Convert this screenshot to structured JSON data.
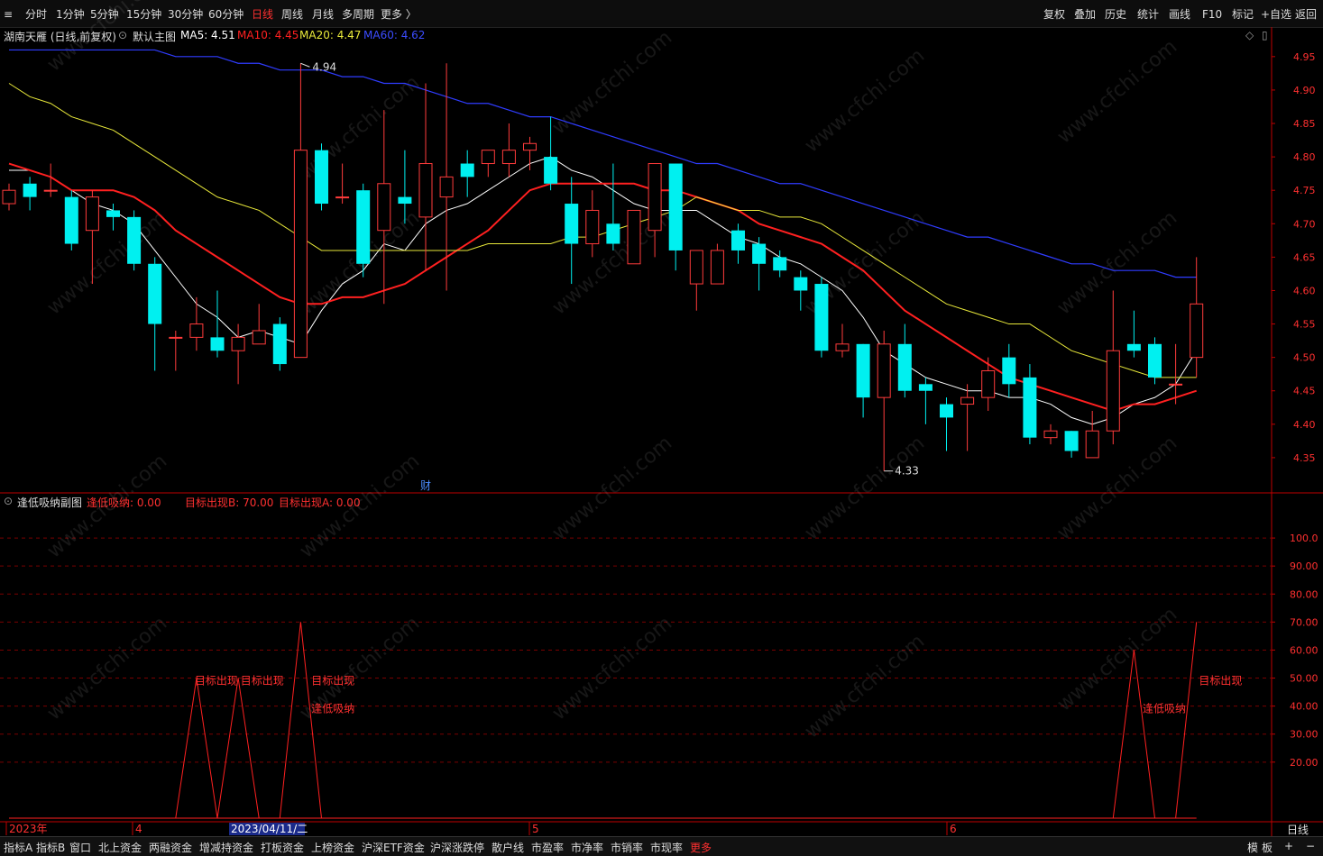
{
  "toolbar": {
    "periods": [
      "分时",
      "1分钟",
      "5分钟",
      "15分钟",
      "30分钟",
      "60分钟",
      "日线",
      "周线",
      "月线",
      "多周期",
      "更多 〉"
    ],
    "active_period": "日线",
    "tools": [
      "复权",
      "叠加",
      "历史",
      "统计",
      "画线",
      "F10",
      "标记",
      "+自选",
      "返回"
    ]
  },
  "main_info": {
    "stock": "湖南天雁 (日线,前复权)",
    "template": "默认主图",
    "ma5": "MA5: 4.51",
    "ma10": "MA10: 4.45",
    "ma20": "MA20: 4.47",
    "ma60": "MA60: 4.62"
  },
  "sub_info": {
    "name": "逢低吸纳副图",
    "v1": "逢低吸纳: 0.00",
    "v2": "目标出现B: 70.00",
    "v3": "目标出现A: 0.00"
  },
  "colors": {
    "up": "#ff3b3b",
    "down": "#00f0f0",
    "ma5": "#ffffff",
    "ma10": "#ff2020",
    "ma20": "#e8e83a",
    "ma60": "#2f3cff",
    "grid": "#7a0000",
    "axis": "#c00000"
  },
  "chart_data": [
    {
      "type": "candlestick",
      "ylim": [
        4.3,
        4.97
      ],
      "y_ticks": [
        "4.95",
        "4.90",
        "4.85",
        "4.80",
        "4.75",
        "4.70",
        "4.65",
        "4.60",
        "4.55",
        "4.50",
        "4.45",
        "4.40",
        "4.35"
      ],
      "x_labels": [
        "2023年",
        "4",
        "5",
        "6"
      ],
      "cursor_date": "2023/04/11/二",
      "period_label": "日线",
      "annotations": {
        "high": "4.94",
        "low": "4.33",
        "event": "财"
      },
      "candles": [
        {
          "o": 4.73,
          "h": 4.76,
          "l": 4.72,
          "c": 4.75
        },
        {
          "o": 4.76,
          "h": 4.77,
          "l": 4.72,
          "c": 4.74
        },
        {
          "o": 4.75,
          "h": 4.79,
          "l": 4.74,
          "c": 4.75
        },
        {
          "o": 4.74,
          "h": 4.75,
          "l": 4.66,
          "c": 4.67
        },
        {
          "o": 4.69,
          "h": 4.75,
          "l": 4.61,
          "c": 4.74
        },
        {
          "o": 4.72,
          "h": 4.73,
          "l": 4.69,
          "c": 4.71
        },
        {
          "o": 4.71,
          "h": 4.72,
          "l": 4.63,
          "c": 4.64
        },
        {
          "o": 4.64,
          "h": 4.65,
          "l": 4.48,
          "c": 4.55
        },
        {
          "o": 4.53,
          "h": 4.54,
          "l": 4.48,
          "c": 4.53
        },
        {
          "o": 4.53,
          "h": 4.59,
          "l": 4.51,
          "c": 4.55
        },
        {
          "o": 4.53,
          "h": 4.6,
          "l": 4.5,
          "c": 4.51
        },
        {
          "o": 4.51,
          "h": 4.55,
          "l": 4.46,
          "c": 4.53
        },
        {
          "o": 4.52,
          "h": 4.58,
          "l": 4.52,
          "c": 4.54
        },
        {
          "o": 4.55,
          "h": 4.56,
          "l": 4.48,
          "c": 4.49
        },
        {
          "o": 4.5,
          "h": 4.94,
          "l": 4.5,
          "c": 4.81
        },
        {
          "o": 4.81,
          "h": 4.82,
          "l": 4.72,
          "c": 4.73
        },
        {
          "o": 4.74,
          "h": 4.79,
          "l": 4.73,
          "c": 4.74
        },
        {
          "o": 4.75,
          "h": 4.76,
          "l": 4.62,
          "c": 4.64
        },
        {
          "o": 4.69,
          "h": 4.87,
          "l": 4.58,
          "c": 4.76
        },
        {
          "o": 4.74,
          "h": 4.81,
          "l": 4.7,
          "c": 4.73
        },
        {
          "o": 4.71,
          "h": 4.91,
          "l": 4.63,
          "c": 4.79
        },
        {
          "o": 4.74,
          "h": 4.94,
          "l": 4.6,
          "c": 4.77
        },
        {
          "o": 4.79,
          "h": 4.81,
          "l": 4.74,
          "c": 4.77
        },
        {
          "o": 4.79,
          "h": 4.81,
          "l": 4.77,
          "c": 4.81
        },
        {
          "o": 4.79,
          "h": 4.85,
          "l": 4.77,
          "c": 4.81
        },
        {
          "o": 4.81,
          "h": 4.83,
          "l": 4.78,
          "c": 4.82
        },
        {
          "o": 4.8,
          "h": 4.86,
          "l": 4.75,
          "c": 4.76
        },
        {
          "o": 4.73,
          "h": 4.77,
          "l": 4.61,
          "c": 4.67
        },
        {
          "o": 4.67,
          "h": 4.75,
          "l": 4.65,
          "c": 4.72
        },
        {
          "o": 4.7,
          "h": 4.79,
          "l": 4.66,
          "c": 4.67
        },
        {
          "o": 4.64,
          "h": 4.72,
          "l": 4.64,
          "c": 4.72
        },
        {
          "o": 4.69,
          "h": 4.79,
          "l": 4.65,
          "c": 4.79
        },
        {
          "o": 4.79,
          "h": 4.79,
          "l": 4.63,
          "c": 4.66
        },
        {
          "o": 4.61,
          "h": 4.66,
          "l": 4.57,
          "c": 4.66
        },
        {
          "o": 4.61,
          "h": 4.67,
          "l": 4.61,
          "c": 4.66
        },
        {
          "o": 4.69,
          "h": 4.7,
          "l": 4.64,
          "c": 4.66
        },
        {
          "o": 4.67,
          "h": 4.68,
          "l": 4.6,
          "c": 4.64
        },
        {
          "o": 4.65,
          "h": 4.66,
          "l": 4.62,
          "c": 4.63
        },
        {
          "o": 4.62,
          "h": 4.63,
          "l": 4.57,
          "c": 4.6
        },
        {
          "o": 4.61,
          "h": 4.62,
          "l": 4.5,
          "c": 4.51
        },
        {
          "o": 4.51,
          "h": 4.55,
          "l": 4.5,
          "c": 4.52
        },
        {
          "o": 4.52,
          "h": 4.52,
          "l": 4.41,
          "c": 4.44
        },
        {
          "o": 4.44,
          "h": 4.54,
          "l": 4.33,
          "c": 4.52
        },
        {
          "o": 4.52,
          "h": 4.55,
          "l": 4.44,
          "c": 4.45
        },
        {
          "o": 4.46,
          "h": 4.47,
          "l": 4.4,
          "c": 4.45
        },
        {
          "o": 4.43,
          "h": 4.44,
          "l": 4.36,
          "c": 4.41
        },
        {
          "o": 4.43,
          "h": 4.46,
          "l": 4.36,
          "c": 4.44
        },
        {
          "o": 4.44,
          "h": 4.5,
          "l": 4.42,
          "c": 4.48
        },
        {
          "o": 4.5,
          "h": 4.52,
          "l": 4.44,
          "c": 4.46
        },
        {
          "o": 4.47,
          "h": 4.49,
          "l": 4.37,
          "c": 4.38
        },
        {
          "o": 4.38,
          "h": 4.4,
          "l": 4.37,
          "c": 4.39
        },
        {
          "o": 4.39,
          "h": 4.39,
          "l": 4.35,
          "c": 4.36
        },
        {
          "o": 4.35,
          "h": 4.42,
          "l": 4.35,
          "c": 4.39
        },
        {
          "o": 4.39,
          "h": 4.6,
          "l": 4.37,
          "c": 4.51
        },
        {
          "o": 4.52,
          "h": 4.57,
          "l": 4.5,
          "c": 4.51
        },
        {
          "o": 4.52,
          "h": 4.53,
          "l": 4.46,
          "c": 4.47
        },
        {
          "o": 4.46,
          "h": 4.52,
          "l": 4.43,
          "c": 4.46
        },
        {
          "o": 4.5,
          "h": 4.65,
          "l": 4.47,
          "c": 4.58
        }
      ],
      "series": [
        {
          "name": "MA5",
          "values": [
            4.78,
            4.78,
            4.77,
            4.75,
            4.73,
            4.72,
            4.7,
            4.66,
            4.62,
            4.58,
            4.56,
            4.53,
            4.54,
            4.53,
            4.52,
            4.57,
            4.61,
            4.63,
            4.67,
            4.66,
            4.7,
            4.72,
            4.73,
            4.75,
            4.77,
            4.79,
            4.8,
            4.78,
            4.77,
            4.75,
            4.73,
            4.72,
            4.72,
            4.72,
            4.7,
            4.68,
            4.67,
            4.65,
            4.64,
            4.62,
            4.6,
            4.56,
            4.51,
            4.49,
            4.47,
            4.46,
            4.45,
            4.45,
            4.44,
            4.44,
            4.43,
            4.41,
            4.4,
            4.41,
            4.43,
            4.44,
            4.46,
            4.51
          ]
        },
        {
          "name": "MA10",
          "values": [
            4.79,
            4.78,
            4.77,
            4.75,
            4.75,
            4.75,
            4.74,
            4.72,
            4.69,
            4.67,
            4.65,
            4.63,
            4.61,
            4.59,
            4.58,
            4.58,
            4.59,
            4.59,
            4.6,
            4.61,
            4.63,
            4.65,
            4.67,
            4.69,
            4.72,
            4.75,
            4.76,
            4.76,
            4.76,
            4.76,
            4.76,
            4.75,
            4.75,
            4.74,
            4.73,
            4.72,
            4.7,
            4.69,
            4.68,
            4.67,
            4.65,
            4.63,
            4.6,
            4.57,
            4.55,
            4.53,
            4.51,
            4.49,
            4.47,
            4.46,
            4.45,
            4.44,
            4.43,
            4.42,
            4.43,
            4.43,
            4.44,
            4.45
          ]
        },
        {
          "name": "MA20",
          "values": [
            4.91,
            4.89,
            4.88,
            4.86,
            4.85,
            4.84,
            4.82,
            4.8,
            4.78,
            4.76,
            4.74,
            4.73,
            4.72,
            4.7,
            4.68,
            4.66,
            4.66,
            4.66,
            4.66,
            4.66,
            4.66,
            4.66,
            4.66,
            4.67,
            4.67,
            4.67,
            4.67,
            4.68,
            4.68,
            4.69,
            4.7,
            4.71,
            4.72,
            4.74,
            4.73,
            4.72,
            4.72,
            4.71,
            4.71,
            4.7,
            4.68,
            4.66,
            4.64,
            4.62,
            4.6,
            4.58,
            4.57,
            4.56,
            4.55,
            4.55,
            4.53,
            4.51,
            4.5,
            4.49,
            4.48,
            4.47,
            4.47,
            4.47
          ]
        },
        {
          "name": "MA60",
          "values": [
            4.96,
            4.96,
            4.96,
            4.96,
            4.96,
            4.96,
            4.96,
            4.96,
            4.95,
            4.95,
            4.95,
            4.94,
            4.94,
            4.93,
            4.93,
            4.93,
            4.92,
            4.92,
            4.91,
            4.91,
            4.9,
            4.89,
            4.88,
            4.88,
            4.87,
            4.86,
            4.86,
            4.85,
            4.84,
            4.83,
            4.82,
            4.81,
            4.8,
            4.79,
            4.79,
            4.78,
            4.77,
            4.76,
            4.76,
            4.75,
            4.74,
            4.73,
            4.72,
            4.71,
            4.7,
            4.69,
            4.68,
            4.68,
            4.67,
            4.66,
            4.65,
            4.64,
            4.64,
            4.63,
            4.63,
            4.63,
            4.62,
            4.62
          ]
        }
      ]
    },
    {
      "type": "line",
      "ylim": [
        0,
        110
      ],
      "y_ticks": [
        "100.0",
        "90.00",
        "80.00",
        "70.00",
        "60.00",
        "50.00",
        "40.00",
        "30.00",
        "20.00"
      ],
      "series": [
        {
          "name": "目标出现B",
          "values": [
            0,
            0,
            0,
            0,
            0,
            0,
            0,
            0,
            0,
            50,
            0,
            50,
            0,
            0,
            70,
            0,
            0,
            0,
            0,
            0,
            0,
            0,
            0,
            0,
            0,
            0,
            0,
            0,
            0,
            0,
            0,
            0,
            0,
            0,
            0,
            0,
            0,
            0,
            0,
            0,
            0,
            0,
            0,
            0,
            0,
            0,
            0,
            0,
            0,
            0,
            0,
            0,
            0,
            0,
            60,
            0,
            0,
            70
          ]
        }
      ],
      "labels": [
        {
          "i": 9,
          "text": "目标出现",
          "y": 49
        },
        {
          "i": 11.2,
          "text": "目标出现",
          "y": 49
        },
        {
          "i": 14.6,
          "text": "目标出现",
          "y": 49
        },
        {
          "i": 14.6,
          "text": "逢低吸纳",
          "y": 39
        },
        {
          "i": 54.5,
          "text": "逢低吸纳",
          "y": 39
        },
        {
          "i": 57.2,
          "text": "目标出现",
          "y": 49
        }
      ],
      "watermark": "www.cfchi.com"
    }
  ],
  "bottom_tabs": [
    "指标A",
    "指标B",
    "窗口",
    "北上资金",
    "两融资金",
    "增减持资金",
    "打板资金",
    "上榜资金",
    "沪深ETF资金",
    "沪深涨跌停",
    "散户线",
    "市盈率",
    "市净率",
    "市销率",
    "市现率",
    "更多"
  ],
  "bottom_right": [
    "模",
    "板",
    "+",
    "−"
  ]
}
